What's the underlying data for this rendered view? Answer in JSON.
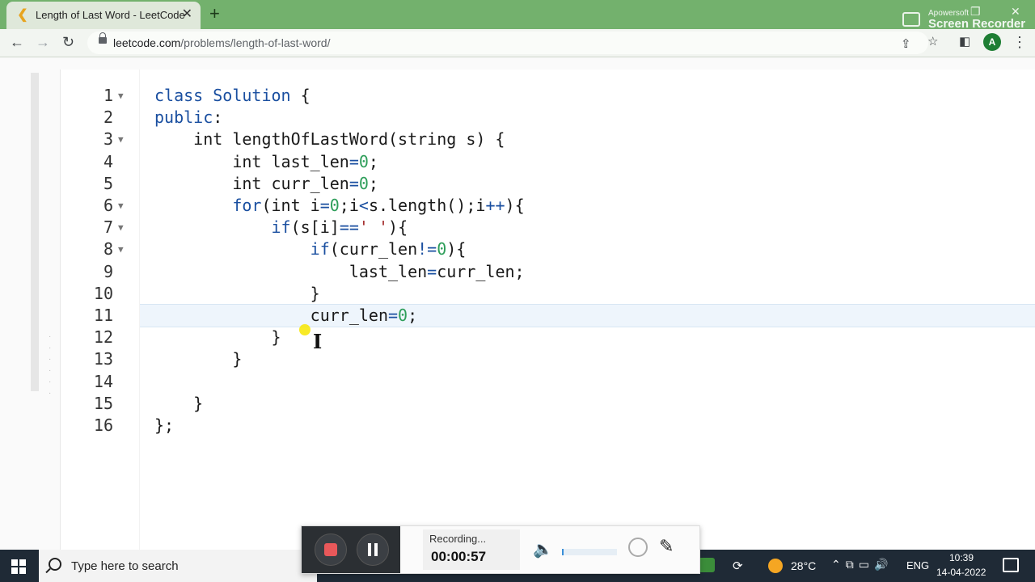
{
  "browser": {
    "tab_title": "Length of Last Word - LeetCode",
    "tab_close": "✕",
    "new_tab": "+",
    "url_host": "leetcode.com",
    "url_path": "/problems/length-of-last-word/",
    "avatar_letter": "A",
    "watermark_line1": "Apowersoft",
    "watermark_line2": "Screen Recorder"
  },
  "editor": {
    "lines": [
      {
        "n": "1",
        "fold": true
      },
      {
        "n": "2",
        "fold": false
      },
      {
        "n": "3",
        "fold": true
      },
      {
        "n": "4",
        "fold": false
      },
      {
        "n": "5",
        "fold": false
      },
      {
        "n": "6",
        "fold": true
      },
      {
        "n": "7",
        "fold": true
      },
      {
        "n": "8",
        "fold": true
      },
      {
        "n": "9",
        "fold": false
      },
      {
        "n": "10",
        "fold": false
      },
      {
        "n": "11",
        "fold": false
      },
      {
        "n": "12",
        "fold": false
      },
      {
        "n": "13",
        "fold": false
      },
      {
        "n": "14",
        "fold": false
      },
      {
        "n": "15",
        "fold": false
      },
      {
        "n": "16",
        "fold": false
      }
    ],
    "active_line": "11"
  },
  "recorder": {
    "status": "Recording...",
    "elapsed": "00:00:57"
  },
  "taskbar": {
    "search_placeholder": "Type here to search",
    "temperature": "28°C",
    "language": "ENG",
    "time": "10:39",
    "date": "14-04-2022"
  },
  "colors": {
    "chrome_green": "#73b16d",
    "keyword_blue": "#1a4fa0",
    "number_green": "#2e9e5a",
    "active_line": "#eef5fc",
    "taskbar": "#1f2a36"
  }
}
